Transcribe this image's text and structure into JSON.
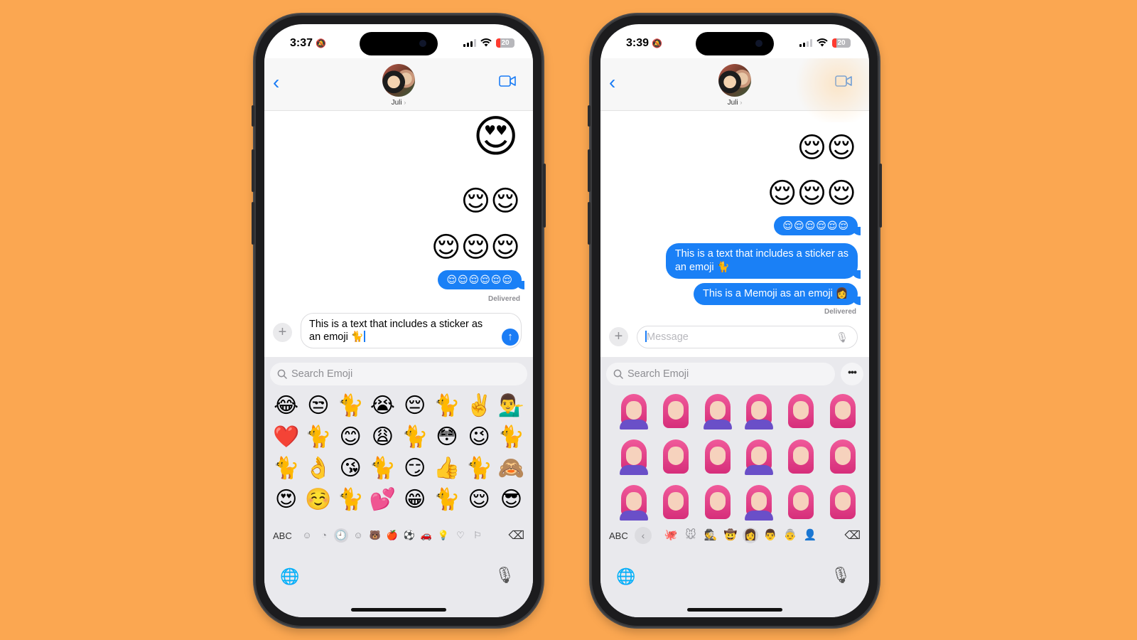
{
  "background_color": "#FBA751",
  "accent_color": "#1A7CF5",
  "phones": [
    {
      "status": {
        "time": "3:37",
        "battery": "20",
        "silent_icon": "bell-slash-icon"
      },
      "header": {
        "contact_name": "Juli",
        "back_icon": "chevron-left-icon",
        "video_icon": "video-camera-icon"
      },
      "thread": {
        "big_emoji": "😍",
        "emoji_row_1": "😌😌",
        "emoji_row_2": "😌😌😌",
        "bubble_emojis": "😌😌😌😌😌😌",
        "delivered": "Delivered"
      },
      "compose": {
        "text_line_1": "This is a text that includes a sticker as",
        "text_line_2": "an emoji 🐈",
        "send_icon": "↑"
      },
      "keyboard": {
        "search_placeholder": "Search Emoji",
        "emoji_grid": [
          "😂",
          "😒",
          "🐈",
          "😭",
          "😔",
          "🐈",
          "✌️",
          "💁‍♂️",
          "❤️",
          "🐈",
          "😊",
          "😩",
          "🐈",
          "😳",
          "😉",
          "🐈",
          "🐈",
          "👌",
          "😘",
          "🐈",
          "😏",
          "👍",
          "🐈",
          "🙈",
          "😍",
          "☺️",
          "🐈",
          "💕",
          "😁",
          "🐈",
          "😌",
          "😎"
        ],
        "abc_label": "ABC",
        "categories": [
          "☺",
          "◔",
          "🕘",
          "☺",
          "🐻",
          "🍎",
          "⚽",
          "🚗",
          "💡",
          "♡",
          "⚐"
        ],
        "active_category_index": 2,
        "delete_icon": "⌫",
        "globe_icon": "🌐",
        "mic_icon": "🎙"
      }
    },
    {
      "status": {
        "time": "3:39",
        "battery": "20",
        "silent_icon": "bell-slash-icon"
      },
      "header": {
        "contact_name": "Juli",
        "back_icon": "chevron-left-icon",
        "video_icon": "video-camera-icon"
      },
      "thread": {
        "emoji_row_1": "😌😌",
        "emoji_row_2": "😌😌😌",
        "bubble_emojis": "😌😌😌😌😌😌",
        "bubble_sticker_line_1": "This is a text that includes a sticker as",
        "bubble_sticker_line_2": "an emoji 🐈",
        "bubble_memoji": "This is a Memoji as an emoji 👩",
        "delivered": "Delivered"
      },
      "compose": {
        "placeholder": "Message"
      },
      "keyboard": {
        "search_placeholder": "Search Emoji",
        "more_label": "•••",
        "memoji_rows": 3,
        "memoji_cols": 6,
        "abc_label": "ABC",
        "back_chevron": "‹",
        "categories": [
          "🐙",
          "🐭",
          "🕵",
          "🤠",
          "👩",
          "👨",
          "👵",
          "👤"
        ],
        "active_category_index": 4,
        "delete_icon": "⌫",
        "globe_icon": "🌐",
        "mic_icon": "🎙"
      }
    }
  ]
}
